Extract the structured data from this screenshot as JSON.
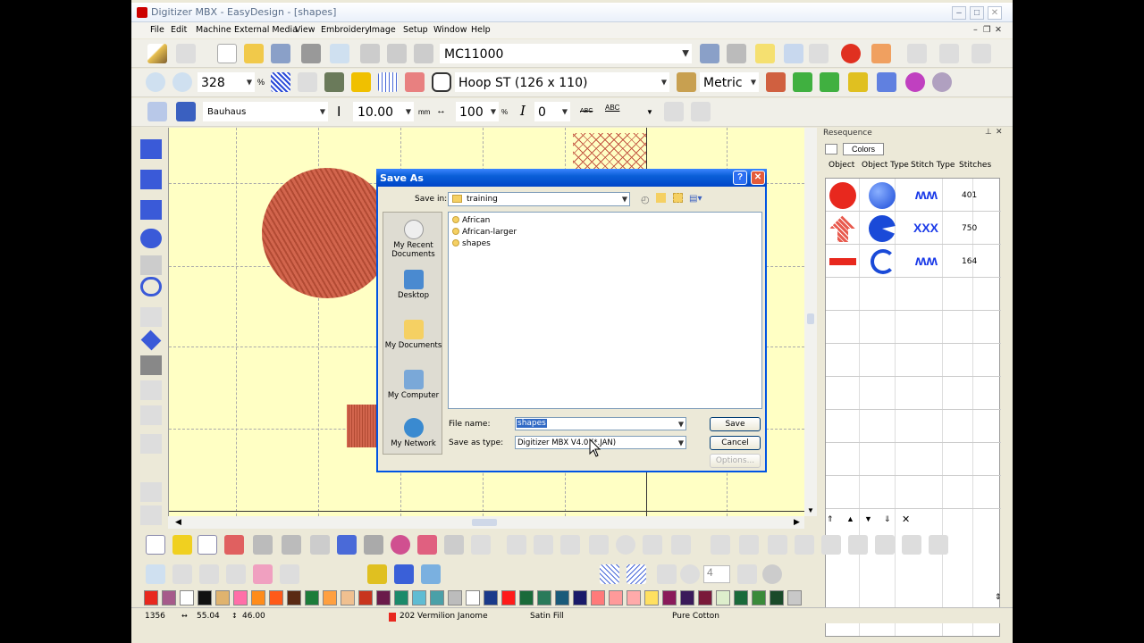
{
  "window": {
    "title": "Digitizer MBX - EasyDesign - [shapes]"
  },
  "menu": [
    "File",
    "Edit",
    "Machine",
    "External Media",
    "View",
    "Embroidery",
    "Image",
    "Setup",
    "Window",
    "Help"
  ],
  "toolbar1": {
    "machine": "MC11000"
  },
  "toolbar2": {
    "zoom": "328",
    "zoom_unit": "%",
    "hoop": "Hoop ST (126 x 110)",
    "units": "Metric"
  },
  "toolbar3": {
    "font": "Bauhaus",
    "size": "10.00",
    "size_unit": "mm",
    "width": "100",
    "width_unit": "%",
    "italic_label": "I",
    "slant": "0",
    "abc1": "ABC",
    "abc2": "ABC"
  },
  "panel": {
    "title": "Resequence",
    "colors_tab": "Colors",
    "headers": [
      "Object",
      "Object Type",
      "Stitch Type",
      "Stitches"
    ],
    "rows": [
      {
        "stitches": "401"
      },
      {
        "stitches": "750"
      },
      {
        "stitches": "164"
      }
    ]
  },
  "dialog": {
    "title": "Save As",
    "save_in_label": "Save in:",
    "save_in_value": "training",
    "places": [
      "My Recent Documents",
      "Desktop",
      "My Documents",
      "My Computer",
      "My Network"
    ],
    "files": [
      "African",
      "African-larger",
      "shapes"
    ],
    "file_name_label": "File name:",
    "file_name_value": "shapes",
    "save_type_label": "Save as type:",
    "save_type_value": "Digitizer MBX V4.0 (*.JAN)",
    "save_button": "Save",
    "cancel_button": "Cancel",
    "options_button": "Options..."
  },
  "bottom": {
    "stepper_value": "4"
  },
  "palette": [
    "#e8281e",
    "#a65a8a",
    "#ffffff",
    "#111111",
    "#e0b36e",
    "#ff6fa8",
    "#ff8c1a",
    "#ff5a1a",
    "#5a2a14",
    "#1c7c3a",
    "#ffa040",
    "#f0c090",
    "#c8341e",
    "#6a1a4a",
    "#1c8a6a",
    "#5fbcd3",
    "#4aa0a8",
    "#bcbcbc",
    "#ffffff",
    "#1a3a8a",
    "#ff1a1a",
    "#1a6a3a",
    "#2a7a5a",
    "#1a5a7a",
    "#1a1a6a",
    "#ff7a7a",
    "#ff9a9a",
    "#ffaaaa",
    "#ffe060",
    "#8a1a5a",
    "#3a1a5a",
    "#7a1a3a",
    "#ddeecc",
    "#1a6a3a",
    "#3a8a3a",
    "#1a4a2a",
    "#c8c8c8"
  ],
  "status": {
    "stitch_count": "1356",
    "width": "55.04",
    "height": "46.00",
    "thread": "202 Vermilion Janome",
    "fill": "Satin Fill",
    "material": "Pure Cotton"
  }
}
